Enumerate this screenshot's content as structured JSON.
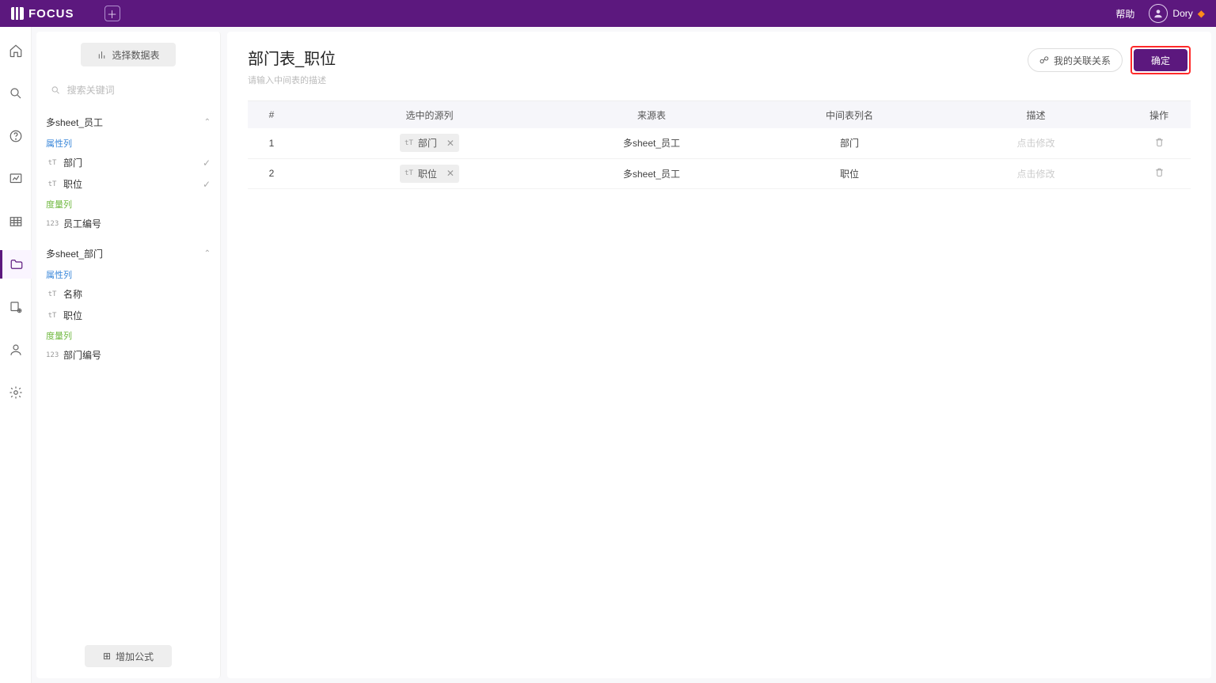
{
  "header": {
    "brand": "FOCUS",
    "help": "帮助",
    "user": "Dory"
  },
  "sidepanel": {
    "select_ds": "选择数据表",
    "search_placeholder": "搜索关键词",
    "add_formula": "增加公式",
    "section_attr": "属性列",
    "section_meas": "度量列",
    "groups": [
      {
        "title": "多sheet_员工",
        "attrs": [
          {
            "type": "tT",
            "name": "部门",
            "checked": true
          },
          {
            "type": "tT",
            "name": "职位",
            "checked": true
          }
        ],
        "meas": [
          {
            "type": "123",
            "name": "员工编号"
          }
        ]
      },
      {
        "title": "多sheet_部门",
        "attrs": [
          {
            "type": "tT",
            "name": "名称"
          },
          {
            "type": "tT",
            "name": "职位"
          }
        ],
        "meas": [
          {
            "type": "123",
            "name": "部门编号"
          }
        ]
      }
    ]
  },
  "main": {
    "title": "部门表_职位",
    "subtitle": "请输入中间表的描述",
    "my_relations": "我的关联关系",
    "confirm": "确定",
    "columns": {
      "idx": "#",
      "src": "选中的源列",
      "srctbl": "来源表",
      "midname": "中间表列名",
      "desc": "描述",
      "op": "操作"
    },
    "desc_placeholder": "点击修改",
    "rows": [
      {
        "idx": "1",
        "chip": "部门",
        "srctbl": "多sheet_员工",
        "midname": "部门"
      },
      {
        "idx": "2",
        "chip": "职位",
        "srctbl": "多sheet_员工",
        "midname": "职位"
      }
    ]
  }
}
